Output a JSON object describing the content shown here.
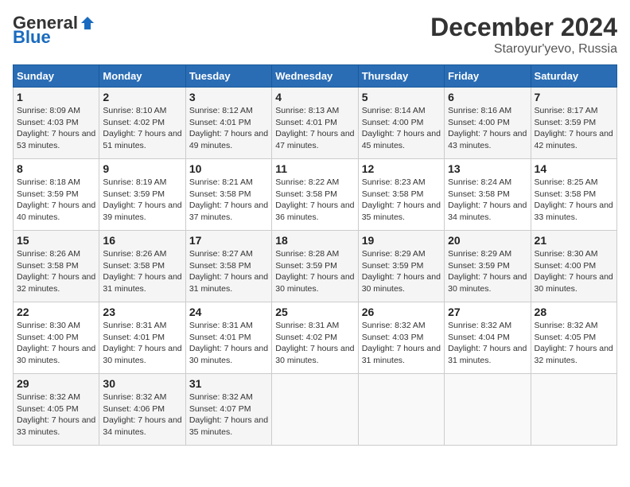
{
  "header": {
    "logo_general": "General",
    "logo_blue": "Blue",
    "month_title": "December 2024",
    "subtitle": "Staroyur'yevo, Russia"
  },
  "weekdays": [
    "Sunday",
    "Monday",
    "Tuesday",
    "Wednesday",
    "Thursday",
    "Friday",
    "Saturday"
  ],
  "weeks": [
    [
      {
        "day": "1",
        "sunrise": "Sunrise: 8:09 AM",
        "sunset": "Sunset: 4:03 PM",
        "daylight": "Daylight: 7 hours and 53 minutes."
      },
      {
        "day": "2",
        "sunrise": "Sunrise: 8:10 AM",
        "sunset": "Sunset: 4:02 PM",
        "daylight": "Daylight: 7 hours and 51 minutes."
      },
      {
        "day": "3",
        "sunrise": "Sunrise: 8:12 AM",
        "sunset": "Sunset: 4:01 PM",
        "daylight": "Daylight: 7 hours and 49 minutes."
      },
      {
        "day": "4",
        "sunrise": "Sunrise: 8:13 AM",
        "sunset": "Sunset: 4:01 PM",
        "daylight": "Daylight: 7 hours and 47 minutes."
      },
      {
        "day": "5",
        "sunrise": "Sunrise: 8:14 AM",
        "sunset": "Sunset: 4:00 PM",
        "daylight": "Daylight: 7 hours and 45 minutes."
      },
      {
        "day": "6",
        "sunrise": "Sunrise: 8:16 AM",
        "sunset": "Sunset: 4:00 PM",
        "daylight": "Daylight: 7 hours and 43 minutes."
      },
      {
        "day": "7",
        "sunrise": "Sunrise: 8:17 AM",
        "sunset": "Sunset: 3:59 PM",
        "daylight": "Daylight: 7 hours and 42 minutes."
      }
    ],
    [
      {
        "day": "8",
        "sunrise": "Sunrise: 8:18 AM",
        "sunset": "Sunset: 3:59 PM",
        "daylight": "Daylight: 7 hours and 40 minutes."
      },
      {
        "day": "9",
        "sunrise": "Sunrise: 8:19 AM",
        "sunset": "Sunset: 3:59 PM",
        "daylight": "Daylight: 7 hours and 39 minutes."
      },
      {
        "day": "10",
        "sunrise": "Sunrise: 8:21 AM",
        "sunset": "Sunset: 3:58 PM",
        "daylight": "Daylight: 7 hours and 37 minutes."
      },
      {
        "day": "11",
        "sunrise": "Sunrise: 8:22 AM",
        "sunset": "Sunset: 3:58 PM",
        "daylight": "Daylight: 7 hours and 36 minutes."
      },
      {
        "day": "12",
        "sunrise": "Sunrise: 8:23 AM",
        "sunset": "Sunset: 3:58 PM",
        "daylight": "Daylight: 7 hours and 35 minutes."
      },
      {
        "day": "13",
        "sunrise": "Sunrise: 8:24 AM",
        "sunset": "Sunset: 3:58 PM",
        "daylight": "Daylight: 7 hours and 34 minutes."
      },
      {
        "day": "14",
        "sunrise": "Sunrise: 8:25 AM",
        "sunset": "Sunset: 3:58 PM",
        "daylight": "Daylight: 7 hours and 33 minutes."
      }
    ],
    [
      {
        "day": "15",
        "sunrise": "Sunrise: 8:26 AM",
        "sunset": "Sunset: 3:58 PM",
        "daylight": "Daylight: 7 hours and 32 minutes."
      },
      {
        "day": "16",
        "sunrise": "Sunrise: 8:26 AM",
        "sunset": "Sunset: 3:58 PM",
        "daylight": "Daylight: 7 hours and 31 minutes."
      },
      {
        "day": "17",
        "sunrise": "Sunrise: 8:27 AM",
        "sunset": "Sunset: 3:58 PM",
        "daylight": "Daylight: 7 hours and 31 minutes."
      },
      {
        "day": "18",
        "sunrise": "Sunrise: 8:28 AM",
        "sunset": "Sunset: 3:59 PM",
        "daylight": "Daylight: 7 hours and 30 minutes."
      },
      {
        "day": "19",
        "sunrise": "Sunrise: 8:29 AM",
        "sunset": "Sunset: 3:59 PM",
        "daylight": "Daylight: 7 hours and 30 minutes."
      },
      {
        "day": "20",
        "sunrise": "Sunrise: 8:29 AM",
        "sunset": "Sunset: 3:59 PM",
        "daylight": "Daylight: 7 hours and 30 minutes."
      },
      {
        "day": "21",
        "sunrise": "Sunrise: 8:30 AM",
        "sunset": "Sunset: 4:00 PM",
        "daylight": "Daylight: 7 hours and 30 minutes."
      }
    ],
    [
      {
        "day": "22",
        "sunrise": "Sunrise: 8:30 AM",
        "sunset": "Sunset: 4:00 PM",
        "daylight": "Daylight: 7 hours and 30 minutes."
      },
      {
        "day": "23",
        "sunrise": "Sunrise: 8:31 AM",
        "sunset": "Sunset: 4:01 PM",
        "daylight": "Daylight: 7 hours and 30 minutes."
      },
      {
        "day": "24",
        "sunrise": "Sunrise: 8:31 AM",
        "sunset": "Sunset: 4:01 PM",
        "daylight": "Daylight: 7 hours and 30 minutes."
      },
      {
        "day": "25",
        "sunrise": "Sunrise: 8:31 AM",
        "sunset": "Sunset: 4:02 PM",
        "daylight": "Daylight: 7 hours and 30 minutes."
      },
      {
        "day": "26",
        "sunrise": "Sunrise: 8:32 AM",
        "sunset": "Sunset: 4:03 PM",
        "daylight": "Daylight: 7 hours and 31 minutes."
      },
      {
        "day": "27",
        "sunrise": "Sunrise: 8:32 AM",
        "sunset": "Sunset: 4:04 PM",
        "daylight": "Daylight: 7 hours and 31 minutes."
      },
      {
        "day": "28",
        "sunrise": "Sunrise: 8:32 AM",
        "sunset": "Sunset: 4:05 PM",
        "daylight": "Daylight: 7 hours and 32 minutes."
      }
    ],
    [
      {
        "day": "29",
        "sunrise": "Sunrise: 8:32 AM",
        "sunset": "Sunset: 4:05 PM",
        "daylight": "Daylight: 7 hours and 33 minutes."
      },
      {
        "day": "30",
        "sunrise": "Sunrise: 8:32 AM",
        "sunset": "Sunset: 4:06 PM",
        "daylight": "Daylight: 7 hours and 34 minutes."
      },
      {
        "day": "31",
        "sunrise": "Sunrise: 8:32 AM",
        "sunset": "Sunset: 4:07 PM",
        "daylight": "Daylight: 7 hours and 35 minutes."
      },
      null,
      null,
      null,
      null
    ]
  ]
}
